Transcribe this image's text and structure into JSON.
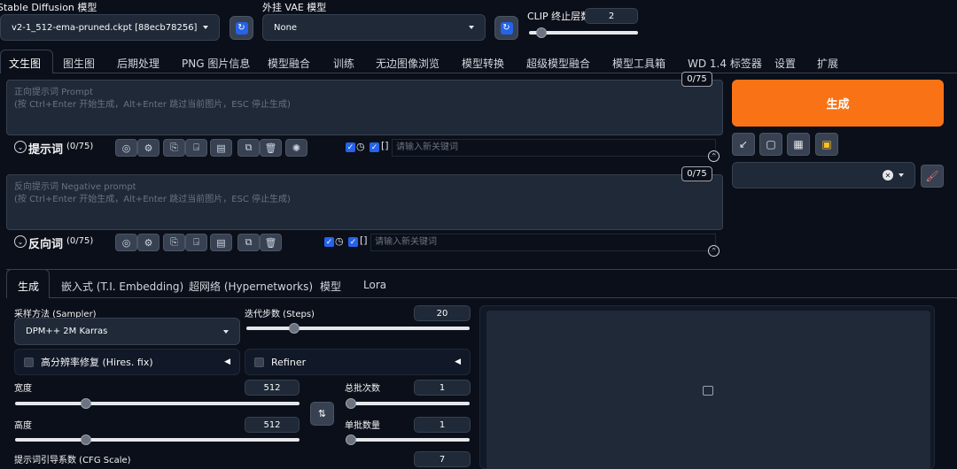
{
  "top": {
    "model_label": "Stable Diffusion 模型",
    "model_value": "v2-1_512-ema-pruned.ckpt [88ecb78256]",
    "vae_label": "外挂 VAE 模型",
    "vae_value": "None",
    "clip_label": "CLIP 终止层数",
    "clip_value": "2"
  },
  "tabs": [
    "文生图",
    "图生图",
    "后期处理",
    "PNG 图片信息",
    "模型融合",
    "训练",
    "无边图像浏览",
    "模型转换",
    "超级模型融合",
    "模型工具箱",
    "WD 1.4 标签器",
    "设置",
    "扩展"
  ],
  "prompt": {
    "placeholder_line1": "正向提示词 Prompt",
    "placeholder_line2": "(按 Ctrl+Enter 开始生成，Alt+Enter 跳过当前图片，ESC 停止生成)",
    "counter": "0/75",
    "title": "提示词",
    "count": "(0/75)",
    "keyword_placeholder": "请输入新关键词"
  },
  "negative": {
    "placeholder_line1": "反向提示词 Negative prompt",
    "placeholder_line2": "(按 Ctrl+Enter 开始生成，Alt+Enter 跳过当前图片，ESC 停止生成)",
    "counter": "0/75",
    "title": "反向词",
    "count": "(0/75)",
    "keyword_placeholder": "请输入新关键词"
  },
  "generate_label": "生成",
  "subtabs": [
    "生成",
    "嵌入式 (T.I. Embedding)",
    "超网络 (Hypernetworks)",
    "模型",
    "Lora"
  ],
  "params": {
    "sampler_label": "采样方法 (Sampler)",
    "sampler_value": "DPM++ 2M Karras",
    "steps_label": "迭代步数 (Steps)",
    "steps_value": "20",
    "steps_level": 0.2,
    "hires_label": "高分辨率修复 (Hires. fix)",
    "refiner_label": "Refiner",
    "width_label": "宽度",
    "width_value": "512",
    "width_level": 0.24,
    "height_label": "高度",
    "height_value": "512",
    "height_level": 0.24,
    "batch_count_label": "总批次数",
    "batch_count_value": "1",
    "batch_size_label": "单批数量",
    "batch_size_value": "1",
    "cfg_label": "提示词引导系数 (CFG Scale)",
    "cfg_value": "7"
  },
  "icons": [
    "refresh-icon",
    "globe-icon",
    "gear-icon",
    "clear-icon",
    "paste-icon",
    "book-icon",
    "copy-icon",
    "trash-icon",
    "openai-icon",
    "clock-icon",
    "arrow-icon",
    "square-icon",
    "basket-icon",
    "clipboard-icon",
    "brush-icon",
    "swap-icon",
    "image-icon",
    "chevron-up-icon",
    "chevron-down-icon"
  ],
  "colors": {
    "accent": "#f97316",
    "checkbox": "#2563eb",
    "background": "#0b0f19"
  }
}
